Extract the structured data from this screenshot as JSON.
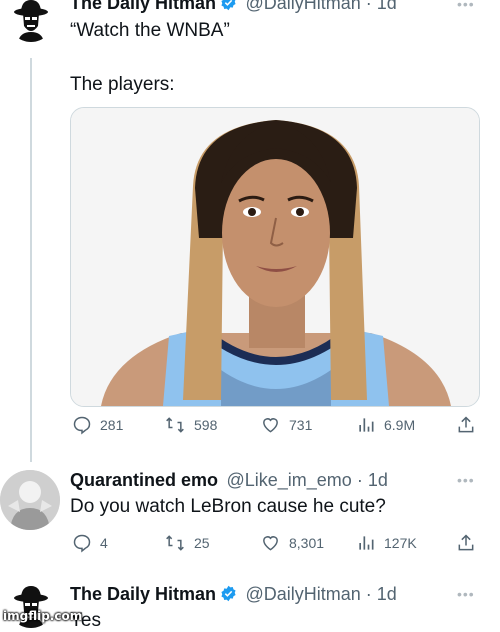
{
  "tweet1": {
    "name": "The Daily Hitman",
    "handle": "@DailyHitman",
    "time": "1d",
    "line1": "“Watch the WNBA”",
    "line2": "The players:",
    "stats": {
      "replies": "281",
      "retweets": "598",
      "likes": "731",
      "views": "6.9M"
    }
  },
  "tweet2": {
    "name": "Quarantined emo",
    "handle": "@Like_im_emo",
    "time": "1d",
    "text": "Do you watch LeBron cause he cute?",
    "stats": {
      "replies": "4",
      "retweets": "25",
      "likes": "8,301",
      "views": "127K"
    }
  },
  "tweet3": {
    "name": "The Daily Hitman",
    "handle": "@DailyHitman",
    "time": "1d",
    "text": "Yes"
  },
  "separator": " · ",
  "more_label": "•••",
  "watermark": "imgflip.com",
  "colors": {
    "verified": "#1d9bf0",
    "secondary": "#536471",
    "thread_line": "#cfd9de"
  },
  "icons": [
    "hitman-logo-icon",
    "verified-badge-icon",
    "reply-icon",
    "retweet-icon",
    "like-icon",
    "views-icon",
    "share-icon",
    "more-icon"
  ]
}
